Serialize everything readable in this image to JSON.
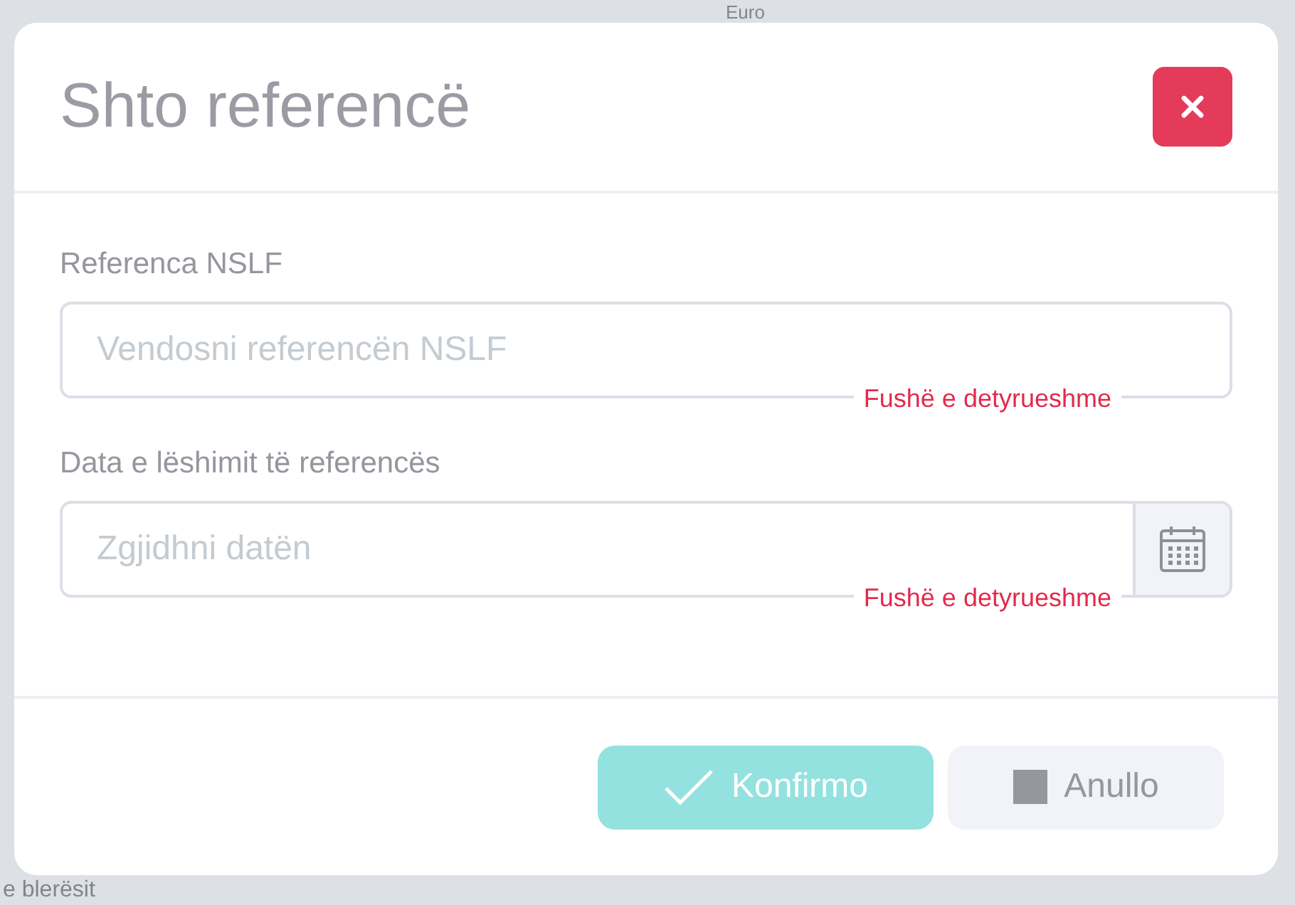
{
  "background": {
    "top_text": "Euro",
    "bottom_text": "e blerësit"
  },
  "modal": {
    "title": "Shto referencë",
    "fields": [
      {
        "kind": "text",
        "label": "Referenca NSLF",
        "placeholder": "Vendosni referencën NSLF",
        "error": "Fushë e detyrueshme"
      },
      {
        "kind": "date",
        "label": "Data e lëshimit të referencës",
        "placeholder": "Zgjidhni datën",
        "error": "Fushë e detyrueshme"
      }
    ],
    "buttons": [
      {
        "kind": "confirm",
        "label": "Konfirmo",
        "disabled": true
      },
      {
        "kind": "cancel",
        "label": "Anullo",
        "disabled": false
      }
    ]
  }
}
